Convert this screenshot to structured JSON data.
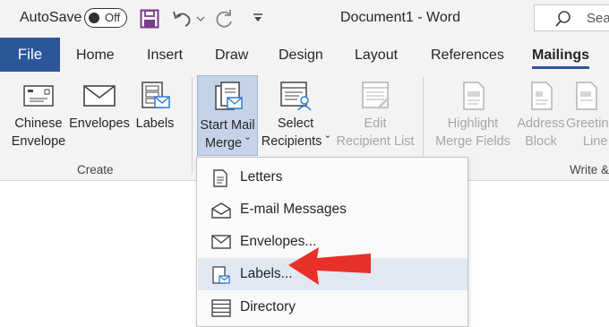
{
  "titlebar": {
    "autosave_label": "AutoSave",
    "autosave_state": "Off",
    "document_title": "Document1  -  Word",
    "search_placeholder": "Sea"
  },
  "tabs": [
    {
      "label": "File"
    },
    {
      "label": "Home"
    },
    {
      "label": "Insert"
    },
    {
      "label": "Draw"
    },
    {
      "label": "Design"
    },
    {
      "label": "Layout"
    },
    {
      "label": "References"
    },
    {
      "label": "Mailings",
      "active": true
    }
  ],
  "ribbon": {
    "create_group": {
      "label": "Create",
      "buttons": {
        "chinese_envelope": {
          "line1": "Chinese",
          "line2": "Envelope"
        },
        "envelopes": {
          "line1": "Envelopes"
        },
        "labels": {
          "line1": "Labels"
        }
      }
    },
    "start_group": {
      "start_mail_merge": {
        "line1": "Start Mail",
        "line2": "Merge ˇ"
      },
      "select_recipients": {
        "line1": "Select",
        "line2": "Recipients ˇ"
      },
      "edit_recipient_list": {
        "line1": "Edit",
        "line2": "Recipient List"
      }
    },
    "write_group": {
      "label": "Write &",
      "highlight_merge_fields": {
        "line1": "Highlight",
        "line2": "Merge Fields"
      },
      "address_block": {
        "line1": "Address",
        "line2": "Block"
      },
      "greeting_line": {
        "line1": "Greetin",
        "line2": "Line"
      }
    }
  },
  "menu": {
    "items": [
      {
        "label": "Letters",
        "icon": "letter-icon"
      },
      {
        "label": "E-mail Messages",
        "icon": "email-icon"
      },
      {
        "label": "Envelopes...",
        "icon": "envelope-icon"
      },
      {
        "label": "Labels...",
        "icon": "labels-icon",
        "highlighted": true
      },
      {
        "label": "Directory",
        "icon": "directory-icon"
      }
    ]
  },
  "colors": {
    "brand": "#2b579a",
    "arrow": "#e8302a",
    "menu_highlight": "#e2e8f2",
    "pressed_button": "#c5d3e8"
  }
}
